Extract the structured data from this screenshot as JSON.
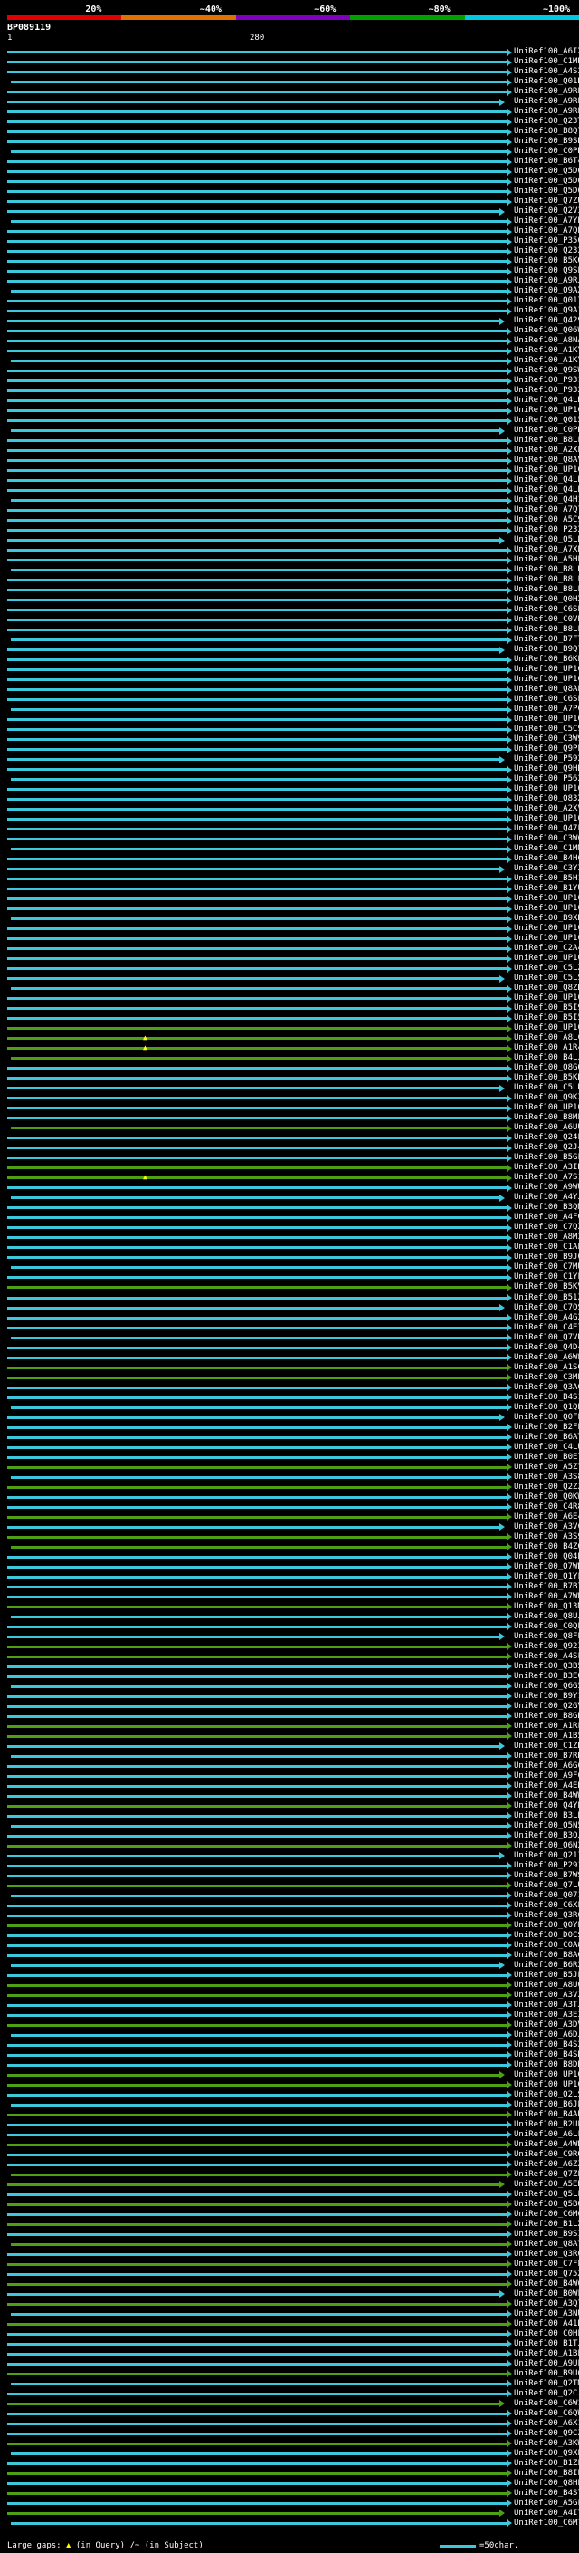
{
  "scale": {
    "labels": [
      "20%",
      "~40%",
      "~60%",
      "~80%",
      "~100%"
    ],
    "colors": [
      "#e00000",
      "#e07000",
      "#8000c0",
      "#00a000",
      "#00c8e0"
    ]
  },
  "query_id": "BP089119",
  "ruler": {
    "start": "1",
    "end": "280"
  },
  "colors": {
    "high": "#3cc8dc",
    "mid": "#4da014",
    "gap_marker": "#ffff00"
  },
  "hits": [
    "UniRef100_A6IXE0",
    "UniRef100_C1MNU4",
    "UniRef100_A4S2R4",
    "UniRef100_Q01DX7",
    "UniRef100_A9RPK9",
    "UniRef100_A9RPH2",
    "UniRef100_A9RP25",
    "UniRef100_Q23TD0",
    "UniRef100_B8Q7B4",
    "UniRef100_B9SRY6",
    "UniRef100_C0PHR4",
    "UniRef100_B6T440",
    "UniRef100_Q5D6C5",
    "UniRef100_Q5D6C4",
    "UniRef100_Q5D6C3",
    "UniRef100_Q7ZUF3",
    "UniRef100_Q2V3J2",
    "UniRef100_A7YB47",
    "UniRef100_A7QB43",
    "UniRef100_P35007",
    "UniRef100_Q23255",
    "UniRef100_B5KQF3",
    "UniRef100_Q9SP37",
    "UniRef100_A9RJA2",
    "UniRef100_Q9AX80",
    "UniRef100_Q01781",
    "UniRef100_Q9A1I5",
    "UniRef100_Q42939",
    "UniRef100_Q06WK5",
    "UniRef100_A8NAW8",
    "UniRef100_A1KYB1",
    "UniRef100_A1KYX0",
    "UniRef100_Q9SWP5",
    "UniRef100_P93172",
    "UniRef100_P93253",
    "UniRef100_Q4LK36",
    "UniRef100_UP1000...",
    "UniRef100_Q015V7",
    "UniRef100_C0PR38",
    "UniRef100_B8LLL7",
    "UniRef100_A2XEU8",
    "UniRef100_Q8AVE1",
    "UniRef100_UP1000...",
    "UniRef100_Q4LB20",
    "UniRef100_Q4LB19",
    "UniRef100_Q4H1Q1",
    "UniRef100_A7Q729",
    "UniRef100_A5C9C1",
    "UniRef100_P23212",
    "UniRef100_Q5LB73",
    "UniRef100_A7XB36",
    "UniRef100_A5HPL4",
    "UniRef100_B8LNU2",
    "UniRef100_B8LLT6",
    "UniRef100_B8LLP3",
    "UniRef100_Q0HXE2",
    "UniRef100_C6SEF4",
    "UniRef100_C0VB22",
    "UniRef100_B8LL02",
    "UniRef100_B7FT14",
    "UniRef100_B9Q7N9",
    "UniRef100_B6KEW5",
    "UniRef100_UP1000...",
    "UniRef100_UP1000...",
    "UniRef100_Q8AE09",
    "UniRef100_C6SLE9",
    "UniRef100_A7PCL5",
    "UniRef100_UP1000...",
    "UniRef100_C5C9B9",
    "UniRef100_C3W905",
    "UniRef100_Q9PEU5",
    "UniRef100_P59240",
    "UniRef100_Q9HRB8",
    "UniRef100_P56246",
    "UniRef100_UP1000...",
    "UniRef100_Q83X57",
    "UniRef100_A2XVP5",
    "UniRef100_UP1000...",
    "UniRef100_Q47L74",
    "UniRef100_C3WCC5",
    "UniRef100_C1MMZ5",
    "UniRef100_B4H6Z9",
    "UniRef100_C3YZJ1",
    "UniRef100_B5H1Q1",
    "UniRef100_B1YUW6",
    "UniRef100_UP1000...",
    "UniRef100_UP1000...",
    "UniRef100_B9XN34",
    "UniRef100_UP1000...",
    "UniRef100_UP1000...",
    "UniRef100_C2A4Y4",
    "UniRef100_UP1000...",
    "UniRef100_C5LXH1",
    "UniRef100_C5LS97",
    "UniRef100_Q8ZDC9",
    "UniRef100_UP1000...",
    "UniRef100_B5I9B5",
    "UniRef100_B5I5S3",
    "UniRef100_UP1000...",
    "UniRef100_A8LCE0",
    "UniRef100_A1R4D6",
    "UniRef100_B4LJ03",
    "UniRef100_Q8GQL7",
    "UniRef100_B5KDE7",
    "UniRef100_C5LRW1",
    "UniRef100_Q9KZM1",
    "UniRef100_UP1000...",
    "UniRef100_B8MEZ4",
    "UniRef100_A6UU72",
    "UniRef100_Q24LN1",
    "UniRef100_Q2J4J2",
    "UniRef100_B5GFX3",
    "UniRef100_A3IDV3",
    "UniRef100_A7S1M6",
    "UniRef100_A9WU61",
    "UniRef100_A4YJU2",
    "UniRef100_B3QMF5",
    "UniRef100_A4FGJ3",
    "UniRef100_C7QZ12",
    "UniRef100_A8M3F7",
    "UniRef100_C1AEU7",
    "UniRef100_B9J0Y0",
    "UniRef100_C7MUK9",
    "UniRef100_C1YL96",
    "UniRef100_B5KVY3",
    "UniRef100_B51ZT7",
    "UniRef100_C7QS33",
    "UniRef100_A4G2J9",
    "UniRef100_C4E768",
    "UniRef100_Q7VUF0",
    "UniRef100_Q4D455",
    "UniRef100_A6WE92",
    "UniRef100_A1SGL1",
    "UniRef100_C3MB49",
    "UniRef100_Q3AGC2",
    "UniRef100_B4S1Z9",
    "UniRef100_Q1QBN4",
    "UniRef100_Q0FE41",
    "UniRef100_B2FPC1",
    "UniRef100_B6ATE2",
    "UniRef100_C4LU18",
    "UniRef100_B0E750",
    "UniRef100_A5ZY00",
    "UniRef100_A3S8B4",
    "UniRef100_Q2ZZ25",
    "UniRef100_Q0KW76",
    "UniRef100_C4R8A0",
    "UniRef100_A6E4P9",
    "UniRef100_A3VCW9",
    "UniRef100_A3S9K4",
    "UniRef100_B4ZG42",
    "UniRef100_Q04BF7",
    "UniRef100_Q7WKN8",
    "UniRef100_Q1YFB2",
    "UniRef100_B7B766",
    "UniRef100_A7WB33",
    "UniRef100_Q13M35",
    "UniRef100_Q8UJ99",
    "UniRef100_C0QE57",
    "UniRef100_Q8FE61",
    "UniRef100_Q92IE1",
    "UniRef100_A4SF77",
    "UniRef100_Q3B532",
    "UniRef100_B3EOY3",
    "UniRef100_Q6G504",
    "UniRef100_B9Y1Y2",
    "UniRef100_Q2GVV8",
    "UniRef100_B8GRF4",
    "UniRef100_A1RFP8",
    "UniRef100_A1B5H5",
    "UniRef100_C1ZHH0",
    "UniRef100_B7RK76",
    "UniRef100_A6G626",
    "UniRef100_A9F015",
    "UniRef100_A4EH43",
    "UniRef100_B4WW54",
    "UniRef100_Q4YBY3",
    "UniRef100_B3LBS4",
    "UniRef100_Q5N562",
    "UniRef100_B3QJT3",
    "UniRef100_Q6N2W5",
    "UniRef100_Q21IR1",
    "UniRef100_P29103",
    "UniRef100_B7WS14",
    "UniRef100_Q7LUX0",
    "UniRef100_Q071V6",
    "UniRef100_C6XL65",
    "UniRef100_Q3R6C1",
    "UniRef100_Q0YP32",
    "UniRef100_D0CS14",
    "UniRef100_C0A877",
    "UniRef100_B8AG62",
    "UniRef100_B6R273",
    "UniRef100_B5JLK7",
    "UniRef100_A8U0F7",
    "UniRef100_A3V279",
    "UniRef100_A3TJW8",
    "UniRef100_A3E342",
    "UniRef100_A3DV79",
    "UniRef100_A6DJJ9",
    "UniRef100_B4S232",
    "UniRef100_B4SD43",
    "UniRef100_B8DR41",
    "UniRef100_UP1000...",
    "UniRef100_UP1000...",
    "UniRef100_Q2LSQ9",
    "UniRef100_B6JE75",
    "UniRef100_B4AU77",
    "UniRef100_B2UP10",
    "UniRef100_A6LFN4",
    "UniRef100_A4WNT6",
    "UniRef100_C9RQQ0",
    "UniRef100_A6ZZ30",
    "UniRef100_Q7ZEH1",
    "UniRef100_A5EN47",
    "UniRef100_Q5LL50",
    "UniRef100_Q5BQ20",
    "UniRef100_C6M655",
    "UniRef100_B1LX16",
    "UniRef100_B9SI06",
    "UniRef100_Q8AYY9",
    "UniRef100_Q3R6Q1",
    "UniRef100_C7FP36",
    "UniRef100_Q75X52",
    "UniRef100_B4W687",
    "UniRef100_B0WF14",
    "UniRef100_A3Q752",
    "UniRef100_A3NUH0",
    "UniRef100_A41D05",
    "UniRef100_C0HEJ1",
    "UniRef100_B1TJW4",
    "UniRef100_A1BE22",
    "UniRef100_A9UL03",
    "UniRef100_B9U053",
    "UniRef100_Q2TMH1",
    "UniRef100_Q2CJM8",
    "UniRef100_C6W147",
    "UniRef100_C6QWP9",
    "UniRef100_A6X1W7",
    "UniRef100_Q9CZ77",
    "UniRef100_A3KWZ0",
    "UniRef100_Q9XE10",
    "UniRef100_B1ZLX0",
    "UniRef100_B8IPU4",
    "UniRef100_Q8HPW6",
    "UniRef100_B4S716",
    "UniRef100_A5GFB8",
    "UniRef100_A4IYF6",
    "UniRef100_C6MTF0"
  ],
  "footer": {
    "large_gaps": "Large gaps:",
    "in_query": "(in Query)",
    "in_subject": "(in Subject)",
    "scale_note": "=50char."
  }
}
